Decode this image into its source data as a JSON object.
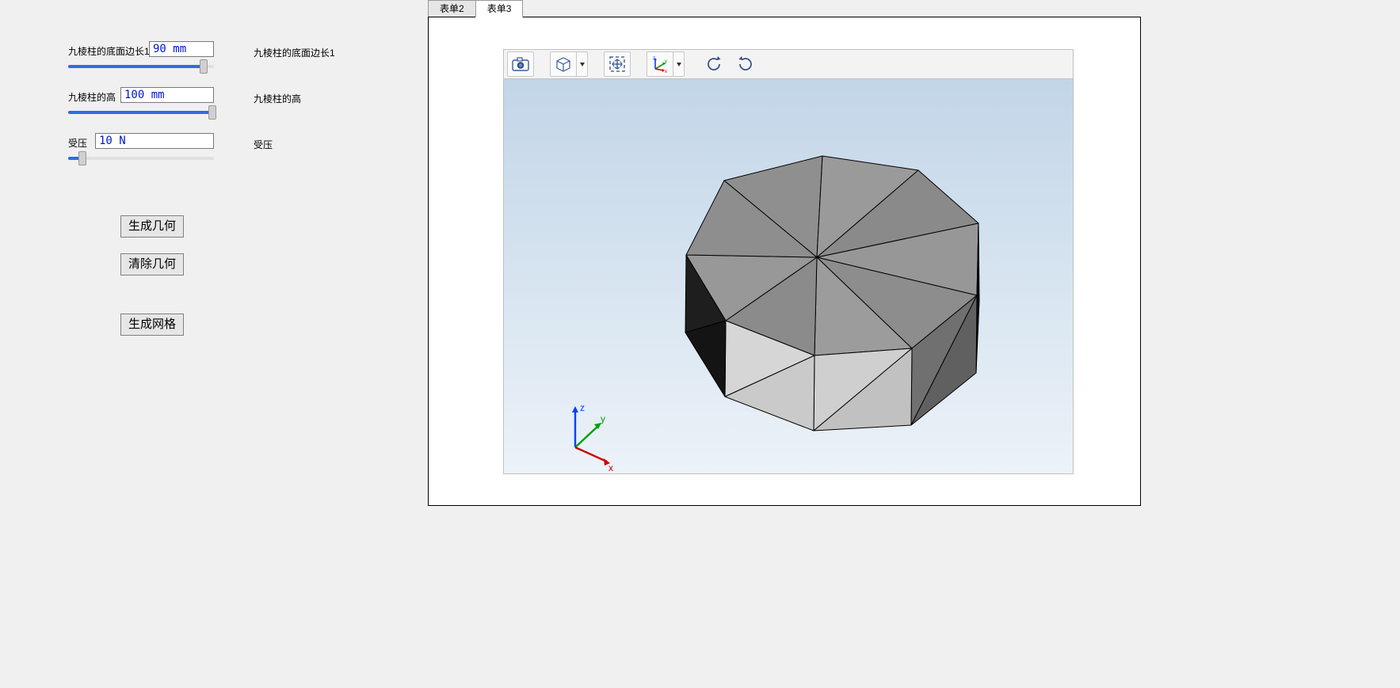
{
  "tabs": [
    {
      "label": "表单2",
      "active": false
    },
    {
      "label": "表单3",
      "active": true
    }
  ],
  "parameters": {
    "edge": {
      "label": "九棱柱的底面边长1",
      "value": "90 mm",
      "right_label": "九棱柱的底面边长1",
      "slider_pct": 93
    },
    "height": {
      "label": "九棱柱的高",
      "value": "100 mm",
      "right_label": "九棱柱的高",
      "slider_pct": 99
    },
    "pressure": {
      "label": "受压",
      "value": "10 N",
      "right_label": "受压",
      "slider_pct": 10
    }
  },
  "buttons": {
    "generate_geometry": "生成几何",
    "clear_geometry": "清除几何",
    "generate_mesh": "生成网格"
  },
  "toolbar_icons": [
    "camera-icon",
    "cube-icon",
    "fit-icon",
    "axes-icon",
    "rotate-ccw-icon",
    "rotate-cw-icon"
  ],
  "axis_labels": {
    "x": "x",
    "y": "y",
    "z": "z"
  }
}
